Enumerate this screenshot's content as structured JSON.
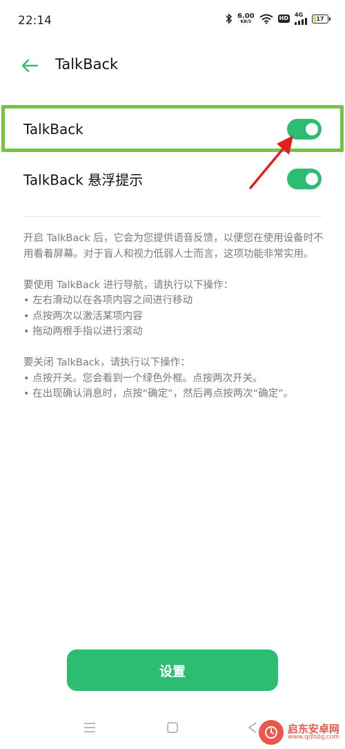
{
  "status_bar": {
    "time": "22:14",
    "net_speed_value": "6.00",
    "net_speed_unit": "KB/S",
    "hd_label": "HD",
    "signal_label": "4G",
    "battery_level": "17",
    "battery_fraction": 0.17,
    "icons": [
      "bluetooth-icon",
      "wifi-icon",
      "signal-icon",
      "battery-icon"
    ]
  },
  "header": {
    "title": "TalkBack",
    "back_icon": "arrow-left-icon"
  },
  "settings": [
    {
      "label": "TalkBack",
      "enabled": true
    },
    {
      "label": "TalkBack 悬浮提示",
      "enabled": true
    }
  ],
  "description": {
    "intro": "开启 TalkBack 后，它会为您提供语音反馈，以便您在使用设备时不用看着屏幕。对于盲人和视力低弱人士而言，这项功能非常实用。",
    "nav_heading": "要使用 TalkBack 进行导航，请执行以下操作：",
    "nav_steps": [
      "• 左右滑动以在各项内容之间进行移动",
      "• 点按两次以激活某项内容",
      "• 拖动两根手指以进行滚动"
    ],
    "off_heading": "要关闭 TalkBack，请执行以下操作：",
    "off_steps": [
      "• 点按开关。您会看到一个绿色外框。点按两次开关。",
      "• 在出现确认消息时，点按“确定”，然后再点按两次“确定”。"
    ]
  },
  "bottom_button": {
    "label": "设置"
  },
  "watermark": {
    "main": "启东安卓网",
    "sub": "www.qdltdq.com"
  },
  "colors": {
    "accent": "#2dbd72",
    "highlight": "#74c442",
    "annotation": "#e02020"
  }
}
